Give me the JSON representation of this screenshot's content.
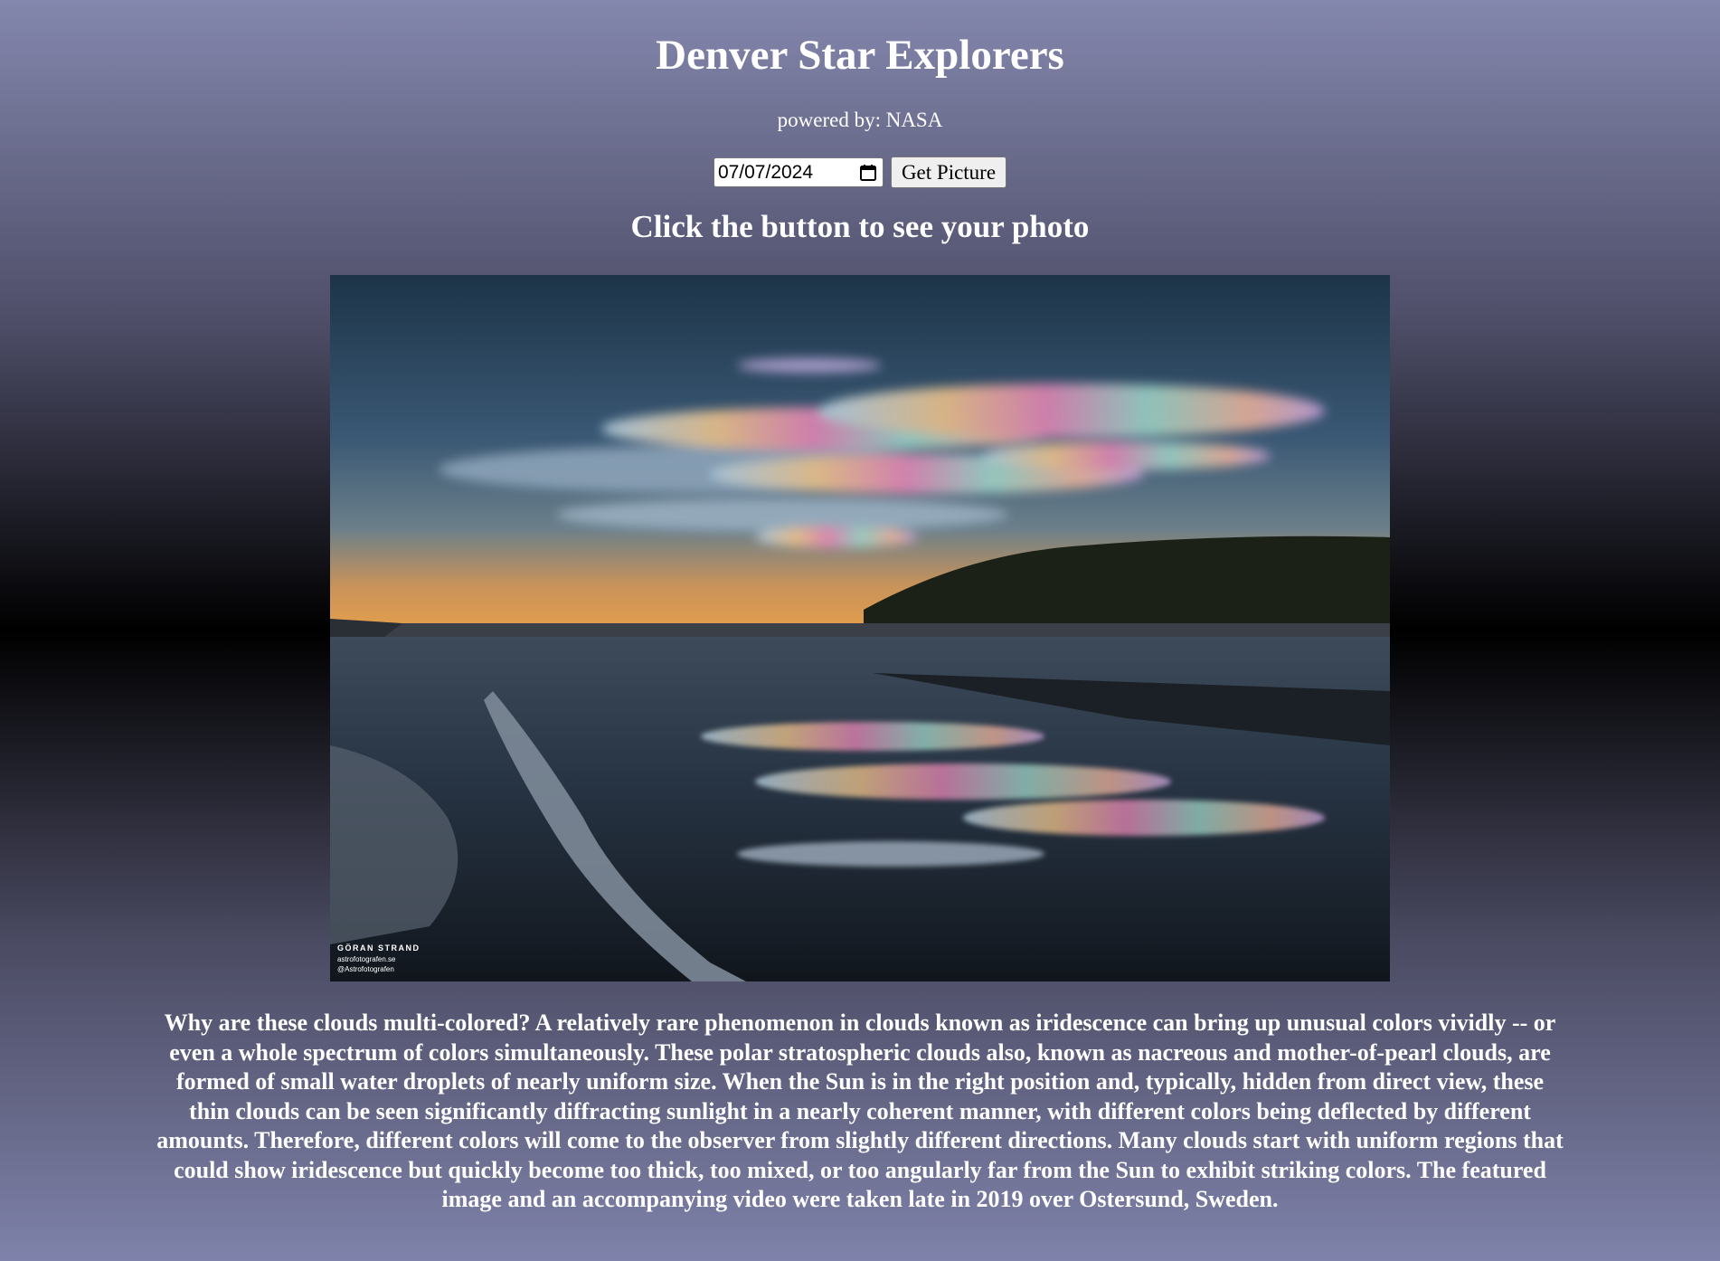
{
  "header": {
    "title": "Denver Star Explorers",
    "powered_by": "powered by: NASA"
  },
  "controls": {
    "date_value": "07/07/2024",
    "button_label": "Get Picture"
  },
  "subtitle": "Click the button to see your photo",
  "photo": {
    "watermark_name": "GÖRAN STRAND",
    "watermark_site": "astrofotografen.se",
    "watermark_handle": "@Astrofotografen"
  },
  "description": "Why are these clouds multi-colored? A relatively rare phenomenon in clouds known as iridescence can bring up unusual colors vividly -- or even a whole spectrum of colors simultaneously. These polar stratospheric clouds also, known as nacreous and mother-of-pearl clouds, are formed of small water droplets of nearly uniform size. When the Sun is in the right position and, typically, hidden from direct view, these thin clouds can be seen significantly diffracting sunlight in a nearly coherent manner, with different colors being deflected by different amounts. Therefore, different colors will come to the observer from slightly different directions. Many clouds start with uniform regions that could show iridescence but quickly become too thick, too mixed, or too angularly far from the Sun to exhibit striking colors. The featured image and an accompanying video were taken late in 2019 over Ostersund, Sweden.",
  "colors": {
    "background_top": "#8487ad",
    "background_middle": "#000000"
  }
}
